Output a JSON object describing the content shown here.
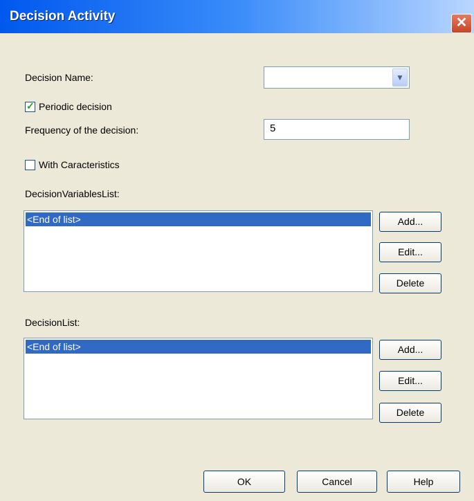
{
  "window": {
    "title": "Decision Activity",
    "close_icon": "close-icon"
  },
  "form": {
    "decision_name_label": "Decision Name:",
    "decision_name_value": "",
    "periodic_label": "Periodic decision",
    "periodic_checked": true,
    "frequency_label": "Frequency of the decision:",
    "frequency_value": "5",
    "characteristics_label": "With Caracteristics",
    "characteristics_checked": false
  },
  "variables_list": {
    "label": "DecisionVariablesList:",
    "items": [
      "<End of list>"
    ],
    "add_label": "Add...",
    "edit_label": "Edit...",
    "delete_label": "Delete"
  },
  "decision_list": {
    "label": "DecisionList:",
    "items": [
      "<End of list>"
    ],
    "add_label": "Add...",
    "edit_label": "Edit...",
    "delete_label": "Delete"
  },
  "footer": {
    "ok_label": "OK",
    "cancel_label": "Cancel",
    "help_label": "Help"
  }
}
